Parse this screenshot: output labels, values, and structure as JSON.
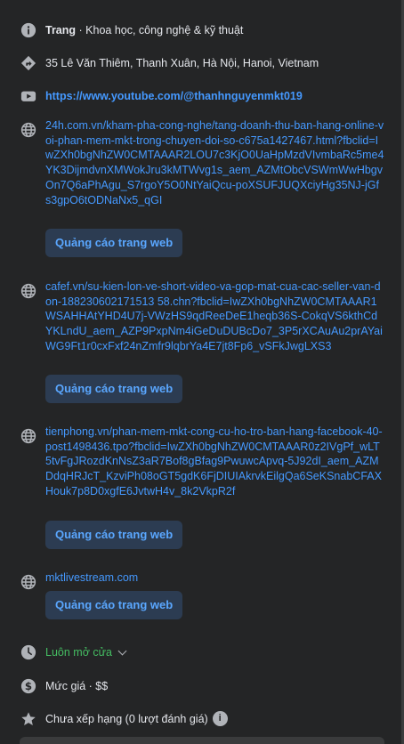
{
  "category": {
    "prefix": "Trang",
    "text": " · Khoa học, công nghệ & kỹ thuật"
  },
  "address": {
    "text": "35 Lê Văn Thiêm, Thanh Xuân, Hà Nội, Hanoi, Vietnam"
  },
  "youtube": {
    "url": "https://www.youtube.com/@thanhnguyenmkt019"
  },
  "websites": [
    {
      "url": "24h.com.vn/kham-pha-cong-nghe/tang-doanh-thu-ban-hang-online-voi-phan-mem-mkt-trong-chuyen-doi-so-c675a1427467.html?fbclid=IwZXh0bgNhZW0CMTAAAR2LOU7c3KjO0UaHpMzdVIvmbaRc5me4YK3DijmdvnXMWokJru3kMTWvg1s_aem_AZMtObcVSWmWwHbgvOn7Q6aPhAgu_S7rgoY5O0NtYaiQcu-poXSUFJUQXciyHg35NJ-jGfs3gpO6tODNaNx5_qGI",
      "ad_label": "Quảng cáo trang web"
    },
    {
      "url": "cafef.vn/su-kien-lon-ve-short-video-va-gop-mat-cua-cac-seller-van-don-188230602171513 58.chn?fbclid=IwZXh0bgNhZW0CMTAAAR1WSAHHAtYHD4U7j-VWzHS9qdReeDeE1heqb36S-CokqVS6kthCdYKLndU_aem_AZP9PxpNm4iGeDuDUBcDo7_3P5rXCAuAu2prAYaiWG9Ft1r0cxFxf24nZmfr9lqbrYa4E7jt8Fp6_vSFkJwgLXS3",
      "ad_label": "Quảng cáo trang web"
    },
    {
      "url": "tienphong.vn/phan-mem-mkt-cong-cu-ho-tro-ban-hang-facebook-40-post1498436.tpo?fbclid=IwZXh0bgNhZW0CMTAAAR0z2IVgPf_wLT5tvFgJRozdKnNsZ3aR7Bof8gBfag9PwuwcApvq-5J92dI_aem_AZMDdqHRJcT_KzviPh08oGT5gdK6FjDIUIAkrvkEilgQa6SeKSnabCFAXHouk7p8D0xgfE6JvtwH4v_8k2VkpR2f",
      "ad_label": "Quảng cáo trang web"
    },
    {
      "url": "mktlivestream.com",
      "ad_label": "Quảng cáo trang web"
    }
  ],
  "hours": {
    "text": "Luôn mở cửa"
  },
  "price": {
    "text": "Mức giá · $$"
  },
  "rating": {
    "text": "Chưa xếp hạng (0 lượt đánh giá)"
  },
  "colors": {
    "link": "#4599ff",
    "green": "#45bd62",
    "ad_button_bg": "#2c3c52",
    "background": "#242526"
  }
}
